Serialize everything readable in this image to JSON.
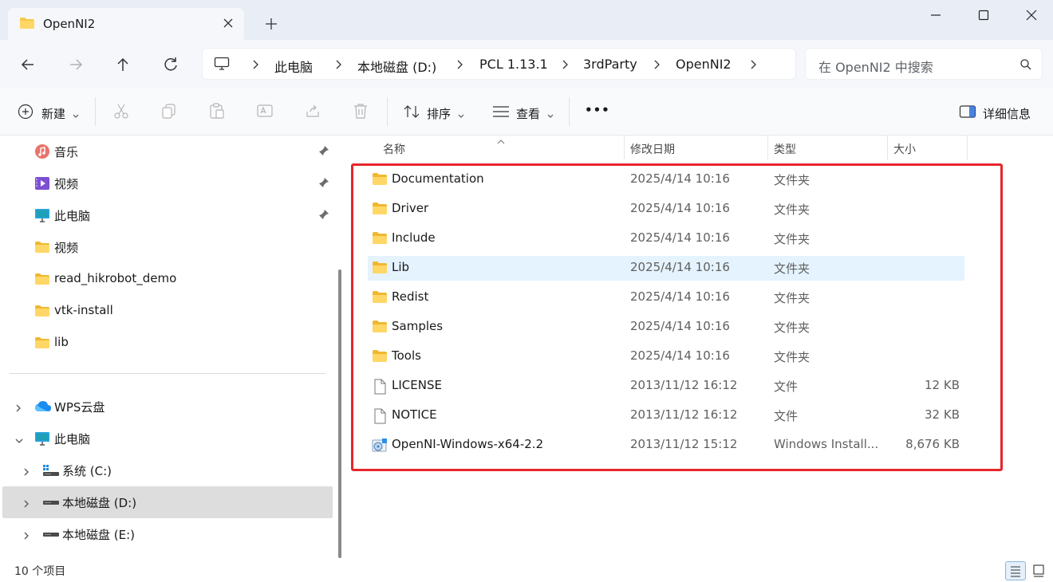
{
  "window": {
    "tab_title": "OpenNI2"
  },
  "nav": {
    "breadcrumbs": [
      "此电脑",
      "本地磁盘 (D:)",
      "PCL 1.13.1",
      "3rdParty",
      "OpenNI2"
    ],
    "search_placeholder": "在 OpenNI2 中搜索"
  },
  "toolbar": {
    "new_label": "新建",
    "sort_label": "排序",
    "view_label": "查看",
    "more_label": "•••",
    "details_label": "详细信息"
  },
  "sidebar": {
    "items": [
      {
        "label": "音乐",
        "icon": "music-icon",
        "pinned": true
      },
      {
        "label": "视频",
        "icon": "video-icon",
        "pinned": true
      },
      {
        "label": "此电脑",
        "icon": "computer-icon",
        "pinned": true
      },
      {
        "label": "视频",
        "icon": "folder-icon",
        "pinned": false
      },
      {
        "label": "read_hikrobot_demo",
        "icon": "folder-icon",
        "pinned": false
      },
      {
        "label": "vtk-install",
        "icon": "folder-icon",
        "pinned": false
      },
      {
        "label": "lib",
        "icon": "folder-icon",
        "pinned": false
      }
    ],
    "tree": [
      {
        "label": "WPS云盘",
        "icon": "cloud-icon",
        "expanded": false
      },
      {
        "label": "此电脑",
        "icon": "computer-icon",
        "expanded": true
      },
      {
        "label": "系统 (C:)",
        "icon": "windows-drive-icon",
        "expanded": false
      },
      {
        "label": "本地磁盘 (D:)",
        "icon": "drive-icon",
        "expanded": false,
        "selected": true
      },
      {
        "label": "本地磁盘 (E:)",
        "icon": "drive-icon",
        "expanded": false
      }
    ]
  },
  "list": {
    "columns": {
      "name": "名称",
      "date": "修改日期",
      "type": "类型",
      "size": "大小"
    },
    "rows": [
      {
        "name": "Documentation",
        "date": "2025/4/14 10:16",
        "type": "文件夹",
        "size": "",
        "icon": "folder-icon"
      },
      {
        "name": "Driver",
        "date": "2025/4/14 10:16",
        "type": "文件夹",
        "size": "",
        "icon": "folder-icon"
      },
      {
        "name": "Include",
        "date": "2025/4/14 10:16",
        "type": "文件夹",
        "size": "",
        "icon": "folder-icon"
      },
      {
        "name": "Lib",
        "date": "2025/4/14 10:16",
        "type": "文件夹",
        "size": "",
        "icon": "folder-icon",
        "selected": true
      },
      {
        "name": "Redist",
        "date": "2025/4/14 10:16",
        "type": "文件夹",
        "size": "",
        "icon": "folder-icon"
      },
      {
        "name": "Samples",
        "date": "2025/4/14 10:16",
        "type": "文件夹",
        "size": "",
        "icon": "folder-icon"
      },
      {
        "name": "Tools",
        "date": "2025/4/14 10:16",
        "type": "文件夹",
        "size": "",
        "icon": "folder-icon"
      },
      {
        "name": "LICENSE",
        "date": "2013/11/12 16:12",
        "type": "文件",
        "size": "12 KB",
        "icon": "file-icon"
      },
      {
        "name": "NOTICE",
        "date": "2013/11/12 16:12",
        "type": "文件",
        "size": "32 KB",
        "icon": "file-icon"
      },
      {
        "name": "OpenNI-Windows-x64-2.2",
        "date": "2013/11/12 15:12",
        "type": "Windows Install...",
        "size": "8,676 KB",
        "icon": "installer-icon"
      }
    ]
  },
  "status": {
    "item_count": "10 个项目"
  },
  "colors": {
    "highlight": "#e6262b",
    "selection": "#e5f3fe",
    "folder": "#f7c948"
  }
}
